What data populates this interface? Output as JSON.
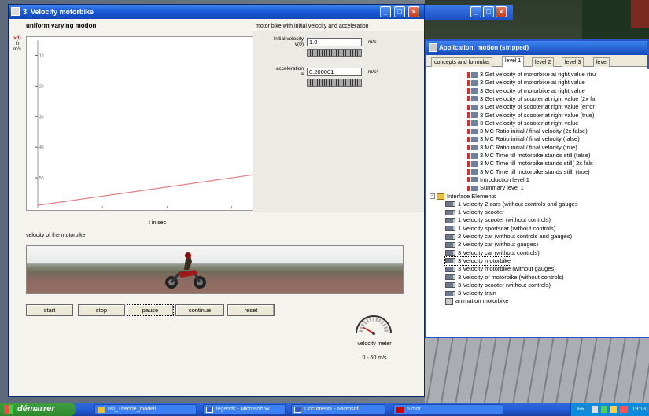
{
  "main_window": {
    "title": "3. Velocity motorbike",
    "section_left": "uniform varying motion",
    "section_right": "motor bike with initial velocity and acceleration",
    "y_unit_top": "v(t)",
    "y_unit_mid": "in",
    "y_unit_bot": "m/s",
    "y_ticks": [
      "50",
      "40",
      "30",
      "20",
      "10"
    ],
    "x_label": "t in sec",
    "scene_label": "velocity of the motorbike",
    "initial_velocity_label": "initial velocity",
    "initial_velocity_sub": "v(0)",
    "initial_velocity_value": "1.0",
    "initial_velocity_unit": "m/s",
    "acceleration_label": "acceleration",
    "acceleration_sub": "a",
    "acceleration_value": "0.200001",
    "acceleration_unit": "m/s²",
    "buttons": [
      "start",
      "stop",
      "pause",
      "continue",
      "reset"
    ],
    "meter_label": "velocity meter",
    "meter_range": "0 - 60 m/s"
  },
  "app_window": {
    "title": "Application: motion (stripped)",
    "tabs": [
      "concepts and formulas",
      "level 1",
      "level 2",
      "level 3",
      "leve"
    ],
    "active_tab": 1,
    "tree": [
      {
        "indent": 2,
        "icon": "red",
        "text": "3 Get velocity of motorbike at right value (tru"
      },
      {
        "indent": 2,
        "icon": "red",
        "text": "3 Get velocity of motorbike at right value"
      },
      {
        "indent": 2,
        "icon": "red",
        "text": "3 Get velocity of motorbike at right value"
      },
      {
        "indent": 2,
        "icon": "red",
        "text": "3 Get velocity of scooter at right value (2x fa"
      },
      {
        "indent": 2,
        "icon": "red",
        "text": "3 Get velocity of scooter at right value (error"
      },
      {
        "indent": 2,
        "icon": "red",
        "text": "3 Get velocity of scooter at right value (true)"
      },
      {
        "indent": 2,
        "icon": "red",
        "text": "3 Get velocity of scooter at right value"
      },
      {
        "indent": 2,
        "icon": "red",
        "text": "3 MC Ratio initial / final velocity (2x false)"
      },
      {
        "indent": 2,
        "icon": "red",
        "text": "3 MC Ratio initial / final velocity (false)"
      },
      {
        "indent": 2,
        "icon": "red",
        "text": "3 MC Ratio initial / final velocity (true)"
      },
      {
        "indent": 2,
        "icon": "red",
        "text": "3 MC Time till motorbike stands still (false)"
      },
      {
        "indent": 2,
        "icon": "red",
        "text": "3 MC Time till motorbike stands still( 2x fals"
      },
      {
        "indent": 2,
        "icon": "red",
        "text": "3 MC Time till motorbike stands still. (true)"
      },
      {
        "indent": 2,
        "icon": "red",
        "text": "Introduction level 1"
      },
      {
        "indent": 2,
        "icon": "red",
        "text": "Summary level 1"
      },
      {
        "indent": 0,
        "icon": "folder",
        "text": "Interface Elements"
      },
      {
        "indent": 1,
        "icon": "gray",
        "text": "1 Velocity 2 cars (without controls and gauges"
      },
      {
        "indent": 1,
        "icon": "gray",
        "text": "1 Velocity scooter"
      },
      {
        "indent": 1,
        "icon": "gray",
        "text": "1 Velocity scooter (without controls)"
      },
      {
        "indent": 1,
        "icon": "gray",
        "text": "1 Velocity sportscar (without controls)"
      },
      {
        "indent": 1,
        "icon": "gray",
        "text": "2 Velocity car (without controls and gauges)"
      },
      {
        "indent": 1,
        "icon": "gray",
        "text": "2 Velocity car (without gauges)"
      },
      {
        "indent": 1,
        "icon": "gray",
        "text": "3 Velocity car (without controls)"
      },
      {
        "indent": 1,
        "icon": "gray",
        "text": "3 Velocity motorbike",
        "selected": true
      },
      {
        "indent": 1,
        "icon": "gray",
        "text": "3 Velocity motorbike (without gauges)"
      },
      {
        "indent": 1,
        "icon": "gray",
        "text": "3 Velocity of motorbike (without controls)"
      },
      {
        "indent": 1,
        "icon": "gray",
        "text": "3 Velocity scooter (without controls)"
      },
      {
        "indent": 1,
        "icon": "gray",
        "text": "3 Velocity train"
      },
      {
        "indent": 1,
        "icon": "star",
        "text": "animation motorbike"
      }
    ]
  },
  "taskbar": {
    "start_label": "démarrer",
    "tasks": [
      {
        "label": "usl_Theorie_modell",
        "kind": "folder"
      },
      {
        "label": "legends - Microsoft W...",
        "kind": "word"
      },
      {
        "label": "Document1 - Microsof...",
        "kind": "word"
      },
      {
        "label": "6 mot",
        "kind": "red"
      }
    ],
    "tray_text": "FR",
    "clock": "19:13"
  },
  "chart_data": {
    "type": "line",
    "xlabel": "t in sec",
    "ylabel": "v(t) in m/s",
    "ylim": [
      0,
      55
    ],
    "xlim": [
      0,
      50
    ],
    "y_ticks": [
      10,
      20,
      30,
      40,
      50
    ],
    "series": [
      {
        "x": [
          0,
          50
        ],
        "y": [
          1.0,
          11.0
        ]
      }
    ]
  }
}
